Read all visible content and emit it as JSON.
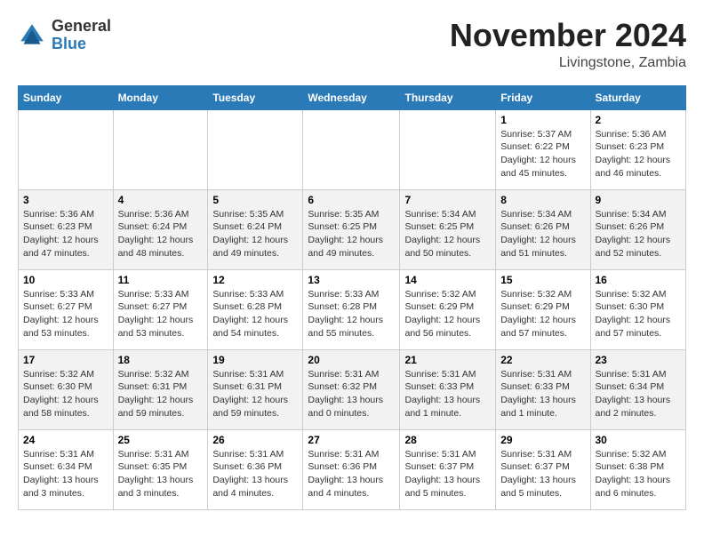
{
  "logo": {
    "general": "General",
    "blue": "Blue"
  },
  "header": {
    "month": "November 2024",
    "location": "Livingstone, Zambia"
  },
  "weekdays": [
    "Sunday",
    "Monday",
    "Tuesday",
    "Wednesday",
    "Thursday",
    "Friday",
    "Saturday"
  ],
  "weeks": [
    [
      {
        "day": "",
        "info": ""
      },
      {
        "day": "",
        "info": ""
      },
      {
        "day": "",
        "info": ""
      },
      {
        "day": "",
        "info": ""
      },
      {
        "day": "",
        "info": ""
      },
      {
        "day": "1",
        "info": "Sunrise: 5:37 AM\nSunset: 6:22 PM\nDaylight: 12 hours and 45 minutes."
      },
      {
        "day": "2",
        "info": "Sunrise: 5:36 AM\nSunset: 6:23 PM\nDaylight: 12 hours and 46 minutes."
      }
    ],
    [
      {
        "day": "3",
        "info": "Sunrise: 5:36 AM\nSunset: 6:23 PM\nDaylight: 12 hours and 47 minutes."
      },
      {
        "day": "4",
        "info": "Sunrise: 5:36 AM\nSunset: 6:24 PM\nDaylight: 12 hours and 48 minutes."
      },
      {
        "day": "5",
        "info": "Sunrise: 5:35 AM\nSunset: 6:24 PM\nDaylight: 12 hours and 49 minutes."
      },
      {
        "day": "6",
        "info": "Sunrise: 5:35 AM\nSunset: 6:25 PM\nDaylight: 12 hours and 49 minutes."
      },
      {
        "day": "7",
        "info": "Sunrise: 5:34 AM\nSunset: 6:25 PM\nDaylight: 12 hours and 50 minutes."
      },
      {
        "day": "8",
        "info": "Sunrise: 5:34 AM\nSunset: 6:26 PM\nDaylight: 12 hours and 51 minutes."
      },
      {
        "day": "9",
        "info": "Sunrise: 5:34 AM\nSunset: 6:26 PM\nDaylight: 12 hours and 52 minutes."
      }
    ],
    [
      {
        "day": "10",
        "info": "Sunrise: 5:33 AM\nSunset: 6:27 PM\nDaylight: 12 hours and 53 minutes."
      },
      {
        "day": "11",
        "info": "Sunrise: 5:33 AM\nSunset: 6:27 PM\nDaylight: 12 hours and 53 minutes."
      },
      {
        "day": "12",
        "info": "Sunrise: 5:33 AM\nSunset: 6:28 PM\nDaylight: 12 hours and 54 minutes."
      },
      {
        "day": "13",
        "info": "Sunrise: 5:33 AM\nSunset: 6:28 PM\nDaylight: 12 hours and 55 minutes."
      },
      {
        "day": "14",
        "info": "Sunrise: 5:32 AM\nSunset: 6:29 PM\nDaylight: 12 hours and 56 minutes."
      },
      {
        "day": "15",
        "info": "Sunrise: 5:32 AM\nSunset: 6:29 PM\nDaylight: 12 hours and 57 minutes."
      },
      {
        "day": "16",
        "info": "Sunrise: 5:32 AM\nSunset: 6:30 PM\nDaylight: 12 hours and 57 minutes."
      }
    ],
    [
      {
        "day": "17",
        "info": "Sunrise: 5:32 AM\nSunset: 6:30 PM\nDaylight: 12 hours and 58 minutes."
      },
      {
        "day": "18",
        "info": "Sunrise: 5:32 AM\nSunset: 6:31 PM\nDaylight: 12 hours and 59 minutes."
      },
      {
        "day": "19",
        "info": "Sunrise: 5:31 AM\nSunset: 6:31 PM\nDaylight: 12 hours and 59 minutes."
      },
      {
        "day": "20",
        "info": "Sunrise: 5:31 AM\nSunset: 6:32 PM\nDaylight: 13 hours and 0 minutes."
      },
      {
        "day": "21",
        "info": "Sunrise: 5:31 AM\nSunset: 6:33 PM\nDaylight: 13 hours and 1 minute."
      },
      {
        "day": "22",
        "info": "Sunrise: 5:31 AM\nSunset: 6:33 PM\nDaylight: 13 hours and 1 minute."
      },
      {
        "day": "23",
        "info": "Sunrise: 5:31 AM\nSunset: 6:34 PM\nDaylight: 13 hours and 2 minutes."
      }
    ],
    [
      {
        "day": "24",
        "info": "Sunrise: 5:31 AM\nSunset: 6:34 PM\nDaylight: 13 hours and 3 minutes."
      },
      {
        "day": "25",
        "info": "Sunrise: 5:31 AM\nSunset: 6:35 PM\nDaylight: 13 hours and 3 minutes."
      },
      {
        "day": "26",
        "info": "Sunrise: 5:31 AM\nSunset: 6:36 PM\nDaylight: 13 hours and 4 minutes."
      },
      {
        "day": "27",
        "info": "Sunrise: 5:31 AM\nSunset: 6:36 PM\nDaylight: 13 hours and 4 minutes."
      },
      {
        "day": "28",
        "info": "Sunrise: 5:31 AM\nSunset: 6:37 PM\nDaylight: 13 hours and 5 minutes."
      },
      {
        "day": "29",
        "info": "Sunrise: 5:31 AM\nSunset: 6:37 PM\nDaylight: 13 hours and 5 minutes."
      },
      {
        "day": "30",
        "info": "Sunrise: 5:32 AM\nSunset: 6:38 PM\nDaylight: 13 hours and 6 minutes."
      }
    ]
  ]
}
